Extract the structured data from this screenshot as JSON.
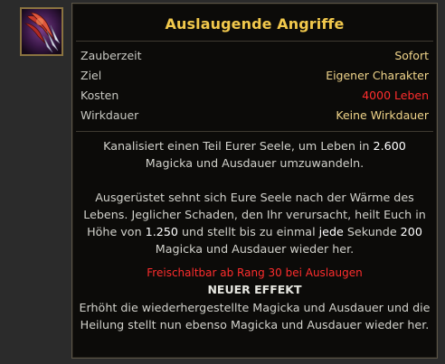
{
  "skill": {
    "title": "Auslaugende Angriffe",
    "icon_name": "draining-claw-icon"
  },
  "stats": [
    {
      "label": "Zauberzeit",
      "value": "Sofort",
      "value_color": "#f0d48a"
    },
    {
      "label": "Ziel",
      "value": "Eigener Charakter",
      "value_color": "#f0d48a"
    },
    {
      "label": "Kosten",
      "value": "4000 Leben",
      "value_color": "#ff2d2d"
    },
    {
      "label": "Wirkdauer",
      "value": "Keine Wirkdauer",
      "value_color": "#f0d48a"
    }
  ],
  "description1": {
    "part1": "Kanalisiert einen Teil Eurer Seele, um Leben in ",
    "hl1": "2.600",
    "part2": "Magicka und Ausdauer umzuwandeln."
  },
  "description2": {
    "part1": "Ausgerüstet sehnt sich Eure Seele nach der Wärme des Lebens. Jeglicher Schaden, den Ihr verursacht, heilt Euch in Höhe von ",
    "hl1": "1.250",
    "part2": " und stellt bis zu einmal ",
    "hl2": "jede",
    "part3": " Sekunde ",
    "hl3": "200",
    "part4": " Magicka und Ausdauer wieder her."
  },
  "unlock_text": "Freischaltbar ab Rang 30 bei Auslaugen",
  "new_effect": {
    "heading": "NEUER EFFEKT",
    "text": "Erhöht die wiederhergestellte Magicka und Ausdauer und die Heilung stellt nun ebenso Magicka und Ausdauer wieder her."
  },
  "colors": {
    "title": "#f2c94c",
    "value": "#f0d48a",
    "cost": "#ff2d2d",
    "body_text": "#d2d2cc",
    "highlight": "#ffffff"
  }
}
